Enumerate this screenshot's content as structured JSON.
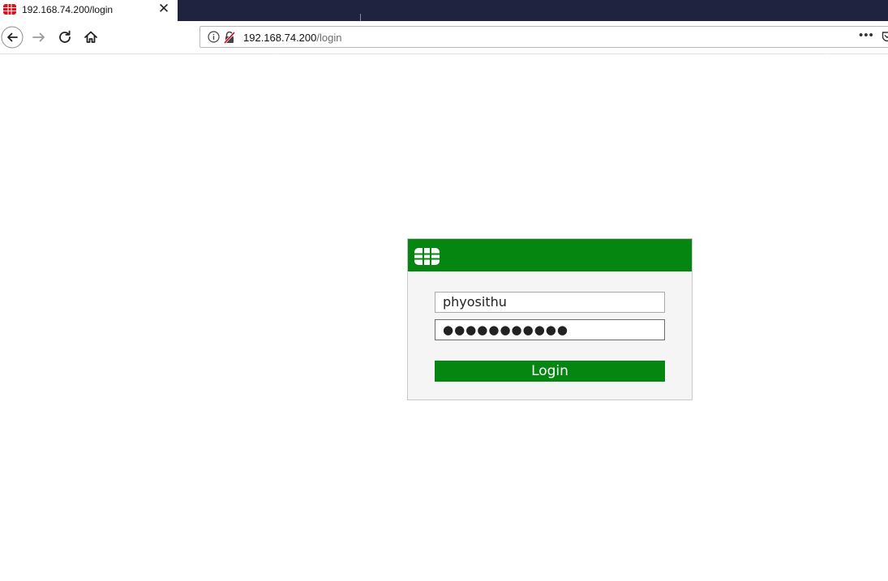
{
  "browser": {
    "tab": {
      "title": "192.168.74.200/login",
      "favicon": "fortinet-logo-icon",
      "close_icon": "close-icon"
    },
    "nav": {
      "back_icon": "back-arrow-icon",
      "forward_icon": "forward-arrow-icon",
      "reload_icon": "reload-icon",
      "home_icon": "home-icon"
    },
    "urlbar": {
      "host": "192.168.74.200",
      "path": "/login",
      "info_icon": "info-icon",
      "insecure_icon": "insecure-lock-icon",
      "more": "•••",
      "pocket_icon": "pocket-icon"
    },
    "colors": {
      "tabstrip": "#202340"
    }
  },
  "login": {
    "logo": "fortinet-logo-icon",
    "username_value": "phyosithu",
    "password_mask": "●●●●●●●●●●●",
    "button_label": "Login",
    "colors": {
      "header": "#048611",
      "button": "#048611",
      "panel": "#f5f5f5"
    }
  }
}
